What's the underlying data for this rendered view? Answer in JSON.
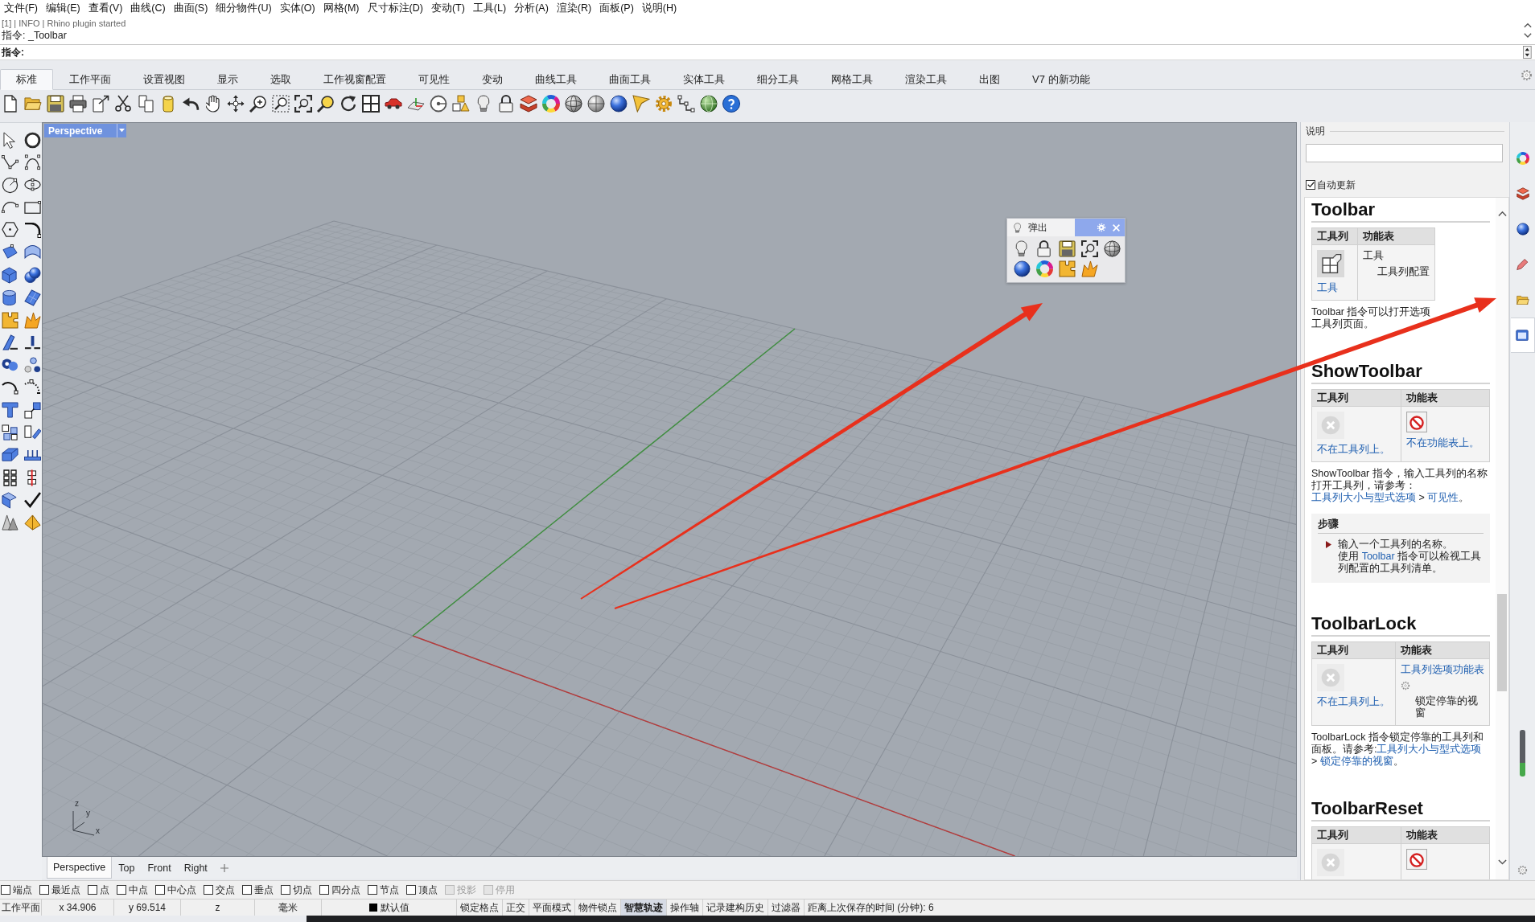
{
  "menu_bar": [
    "文件(F)",
    "编辑(E)",
    "查看(V)",
    "曲线(C)",
    "曲面(S)",
    "细分物件(U)",
    "实体(O)",
    "网格(M)",
    "尺寸标注(D)",
    "变动(T)",
    "工具(L)",
    "分析(A)",
    "渲染(R)",
    "面板(P)",
    "说明(H)"
  ],
  "command_history": [
    "[1] | INFO | Rhino plugin started",
    "指令: _Toolbar"
  ],
  "command_prompt": "指令:",
  "ribbon_tabs": [
    {
      "label": "标准",
      "selected": true
    },
    {
      "label": "工作平面",
      "selected": false
    },
    {
      "label": "设置视图",
      "selected": false
    },
    {
      "label": "显示",
      "selected": false
    },
    {
      "label": "选取",
      "selected": false
    },
    {
      "label": "工作视窗配置",
      "selected": false
    },
    {
      "label": "可见性",
      "selected": false
    },
    {
      "label": "变动",
      "selected": false
    },
    {
      "label": "曲线工具",
      "selected": false
    },
    {
      "label": "曲面工具",
      "selected": false
    },
    {
      "label": "实体工具",
      "selected": false
    },
    {
      "label": "细分工具",
      "selected": false
    },
    {
      "label": "网格工具",
      "selected": false
    },
    {
      "label": "渲染工具",
      "selected": false
    },
    {
      "label": "出图",
      "selected": false
    },
    {
      "label": "V7 的新功能",
      "selected": false
    }
  ],
  "viewport": {
    "title": "Perspective",
    "axis_labels": [
      "z",
      "y",
      "x"
    ],
    "popup": {
      "title": "弹出"
    }
  },
  "viewport_tabs": [
    {
      "label": "Perspective",
      "selected": true
    },
    {
      "label": "Top",
      "selected": false
    },
    {
      "label": "Front",
      "selected": false
    },
    {
      "label": "Right",
      "selected": false
    }
  ],
  "help_panel": {
    "title": "说明",
    "auto_update": {
      "label": "自动更新",
      "checked": true
    },
    "topics": [
      {
        "title": "Toolbar",
        "columns": [
          "工具列",
          "功能表"
        ],
        "toolbar_cell": {
          "kind": "button",
          "link": "工具"
        },
        "menu_cell": {
          "kind": "path",
          "item": {
            "label": "工具",
            "children": [
              {
                "label": "工具列配置"
              }
            ]
          }
        },
        "description": [
          {
            "kind": "text",
            "text": "Toolbar 指令可以打开选项"
          },
          {
            "kind": "covered"
          },
          {
            "kind": "text",
            "text": "工具列页面。"
          }
        ]
      },
      {
        "title": "ShowToolbar",
        "columns": [
          "工具列",
          "功能表"
        ],
        "toolbar_cell": {
          "kind": "none",
          "link": "不在工具列上。"
        },
        "menu_cell": {
          "kind": "none",
          "link": "不在功能表上。"
        },
        "description": [
          {
            "kind": "text",
            "text": "ShowToolbar 指令，输入工具列的名称打开工具列，请参考："
          },
          {
            "kind": "link",
            "text": "工具列大小与型式选项"
          },
          {
            "kind": "text",
            "text": " > "
          },
          {
            "kind": "link",
            "text": "可见性"
          },
          {
            "kind": "text",
            "text": "。"
          }
        ],
        "steps": {
          "title": "步骤",
          "items": [
            {
              "text": "输入一个工具列的名称。",
              "note": [
                {
                  "kind": "text",
                  "text": "使用 "
                },
                {
                  "kind": "link",
                  "text": "Toolbar"
                },
                {
                  "kind": "text",
                  "text": " 指令可以检视工具列配置的工具列清单。"
                }
              ]
            }
          ]
        }
      },
      {
        "title": "ToolbarLock",
        "columns": [
          "工具列",
          "功能表"
        ],
        "toolbar_cell": {
          "kind": "none",
          "link": "不在工具列上。"
        },
        "menu_cell": {
          "kind": "context",
          "link": "工具列选项功能表",
          "text": "锁定停靠的视窗"
        },
        "description": [
          {
            "kind": "text",
            "text": "ToolbarLock 指令锁定停靠的工具列和面板。请参考:"
          },
          {
            "kind": "link",
            "text": "工具列大小与型式选项"
          },
          {
            "kind": "text",
            "text": " > "
          },
          {
            "kind": "link",
            "text": "锁定停靠的视窗"
          },
          {
            "kind": "text",
            "text": "。"
          }
        ]
      },
      {
        "title": "ToolbarReset",
        "columns": [
          "工具列",
          "功能表"
        ],
        "toolbar_cell": {
          "kind": "none"
        },
        "menu_cell": {
          "kind": "none"
        }
      }
    ]
  },
  "side_tabs": [
    {
      "kind": "color",
      "selected": false
    },
    {
      "kind": "layers",
      "selected": false
    },
    {
      "kind": "material",
      "selected": false
    },
    {
      "kind": "brush",
      "selected": false
    },
    {
      "kind": "folder",
      "selected": false
    },
    {
      "kind": "help",
      "selected": true
    }
  ],
  "osnaps": [
    {
      "label": "端点",
      "checked": false,
      "disabled": false
    },
    {
      "label": "最近点",
      "checked": false,
      "disabled": false
    },
    {
      "label": "点",
      "checked": false,
      "disabled": false
    },
    {
      "label": "中点",
      "checked": false,
      "disabled": false
    },
    {
      "label": "中心点",
      "checked": false,
      "disabled": false
    },
    {
      "label": "交点",
      "checked": false,
      "disabled": false
    },
    {
      "label": "垂点",
      "checked": false,
      "disabled": false
    },
    {
      "label": "切点",
      "checked": false,
      "disabled": false
    },
    {
      "label": "四分点",
      "checked": false,
      "disabled": false
    },
    {
      "label": "节点",
      "checked": false,
      "disabled": false
    },
    {
      "label": "顶点",
      "checked": false,
      "disabled": false
    },
    {
      "label": "投影",
      "checked": false,
      "disabled": true
    },
    {
      "label": "停用",
      "checked": false,
      "disabled": true
    }
  ],
  "status_bar": {
    "cplane": "工作平面",
    "x": "x 34.906",
    "y": "y 69.514",
    "z": "z",
    "units": "毫米",
    "layer": "默认值",
    "toggles": [
      {
        "label": "锁定格点",
        "on": false
      },
      {
        "label": "正交",
        "on": false
      },
      {
        "label": "平面模式",
        "on": false
      },
      {
        "label": "物件锁点",
        "on": false
      },
      {
        "label": "智慧轨迹",
        "on": true
      },
      {
        "label": "操作轴",
        "on": false
      },
      {
        "label": "记录建构历史",
        "on": false
      },
      {
        "label": "过滤器",
        "on": false
      }
    ],
    "save_timer": "距离上次保存的时间 (分钟): 6"
  }
}
